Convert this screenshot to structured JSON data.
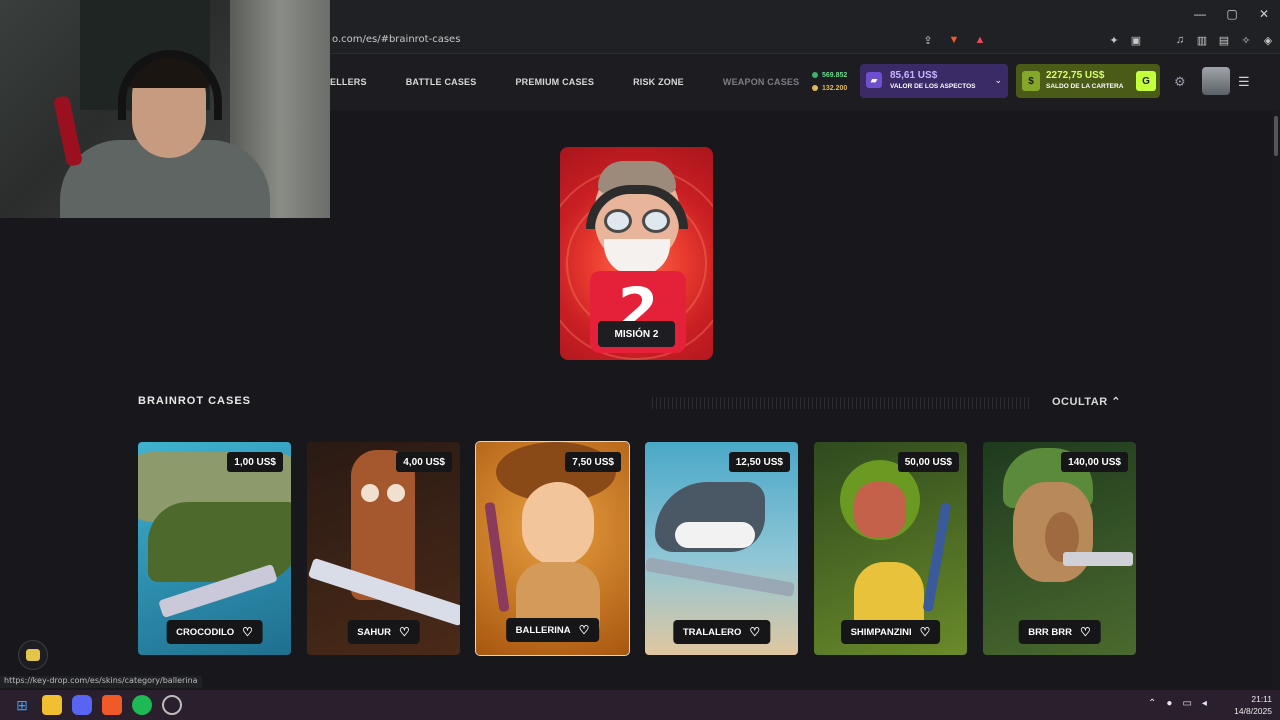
{
  "browser": {
    "url": "o.com/es/#brainrot-cases",
    "window_controls": [
      "—",
      "▢",
      "✕"
    ]
  },
  "header": {
    "nav": [
      {
        "label": "ELLERS",
        "dim": false
      },
      {
        "label": "BATTLE CASES",
        "dim": false
      },
      {
        "label": "PREMIUM CASES",
        "dim": false
      },
      {
        "label": "RISK ZONE",
        "dim": false
      },
      {
        "label": "WEAPON CASES",
        "dim": true
      }
    ],
    "stat_green": "569.852",
    "stat_gold": "132.200",
    "skins_value": "85,61 US$",
    "skins_label": "VALOR DE LOS ASPECTOS",
    "wallet_value": "2272,75 US$",
    "wallet_label": "SALDO DE LA CARTERA",
    "wallet_button": "G"
  },
  "mission": {
    "label": "MISIÓN 2",
    "number": "2"
  },
  "section": {
    "title": "BRAINROT CASES",
    "hide_label": "OCULTAR"
  },
  "cases": [
    {
      "name": "CROCODILO",
      "price": "1,00 US$"
    },
    {
      "name": "SAHUR",
      "price": "4,00 US$"
    },
    {
      "name": "BALLERINA",
      "price": "7,50 US$"
    },
    {
      "name": "TRALALERO",
      "price": "12,50 US$"
    },
    {
      "name": "SHIMPANZINI",
      "price": "50,00 US$"
    },
    {
      "name": "BRR BRR",
      "price": "140,00 US$"
    }
  ],
  "status_url": "https://key-drop.com/es/skins/category/ballerina",
  "taskbar": {
    "time": "21:11",
    "date": "14/8/2025"
  },
  "colors": {
    "background": "#18181c",
    "skins_box": "#3a2a66",
    "wallet_box": "#4a5a17",
    "wallet_accent": "#c3ff3a"
  }
}
